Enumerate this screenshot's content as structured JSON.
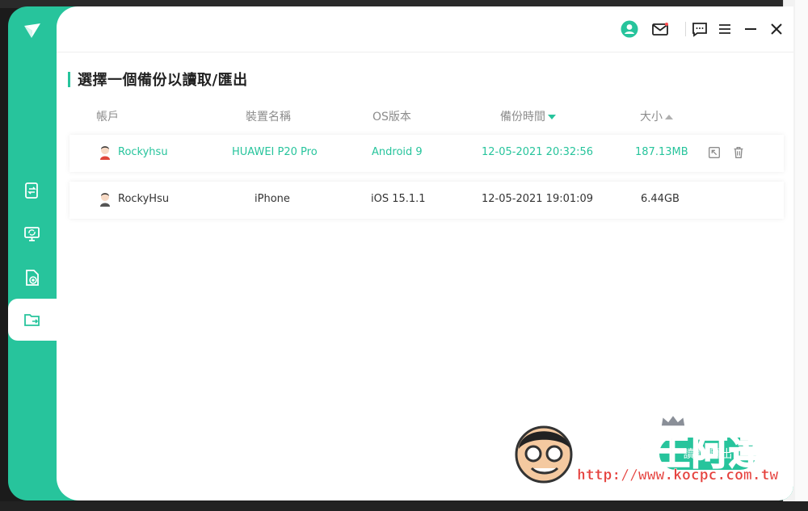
{
  "window": {
    "controls": {
      "account_icon": "account-circle-icon",
      "mail_icon": "mail-icon",
      "feedback_icon": "chat-icon",
      "menu_icon": "hamburger-icon",
      "minimize_icon": "minimize-icon",
      "close_icon": "close-icon"
    }
  },
  "sidebar": {
    "items": [
      {
        "name": "backup",
        "icon": "document-transfer-icon"
      },
      {
        "name": "restore",
        "icon": "monitor-sync-icon"
      },
      {
        "name": "add-backup",
        "icon": "file-add-icon"
      },
      {
        "name": "export",
        "icon": "folder-export-icon",
        "active": true
      }
    ]
  },
  "main": {
    "heading": "選擇一個備份以讀取/匯出",
    "columns": {
      "account": "帳戶",
      "device": "裝置名稱",
      "os": "OS版本",
      "time": "備份時間",
      "size": "大小"
    },
    "rows": [
      {
        "account": "Rockyhsu",
        "device": "HUAWEI P20 Pro",
        "os": "Android 9",
        "time": "12-05-2021 20:32:56",
        "size": "187.13MB",
        "selected": true
      },
      {
        "account": "RockyHsu",
        "device": "iPhone",
        "os": "iOS 15.1.1",
        "time": "12-05-2021 19:01:09",
        "size": "6.44GB",
        "selected": false
      }
    ],
    "read_button": "讀取/匯出"
  },
  "watermark": {
    "title": "電腦王阿達",
    "url": "http://www.kocpc.com.tw"
  },
  "colors": {
    "accent": "#27c49c",
    "text": "#333333",
    "muted": "#8c8c8c"
  }
}
